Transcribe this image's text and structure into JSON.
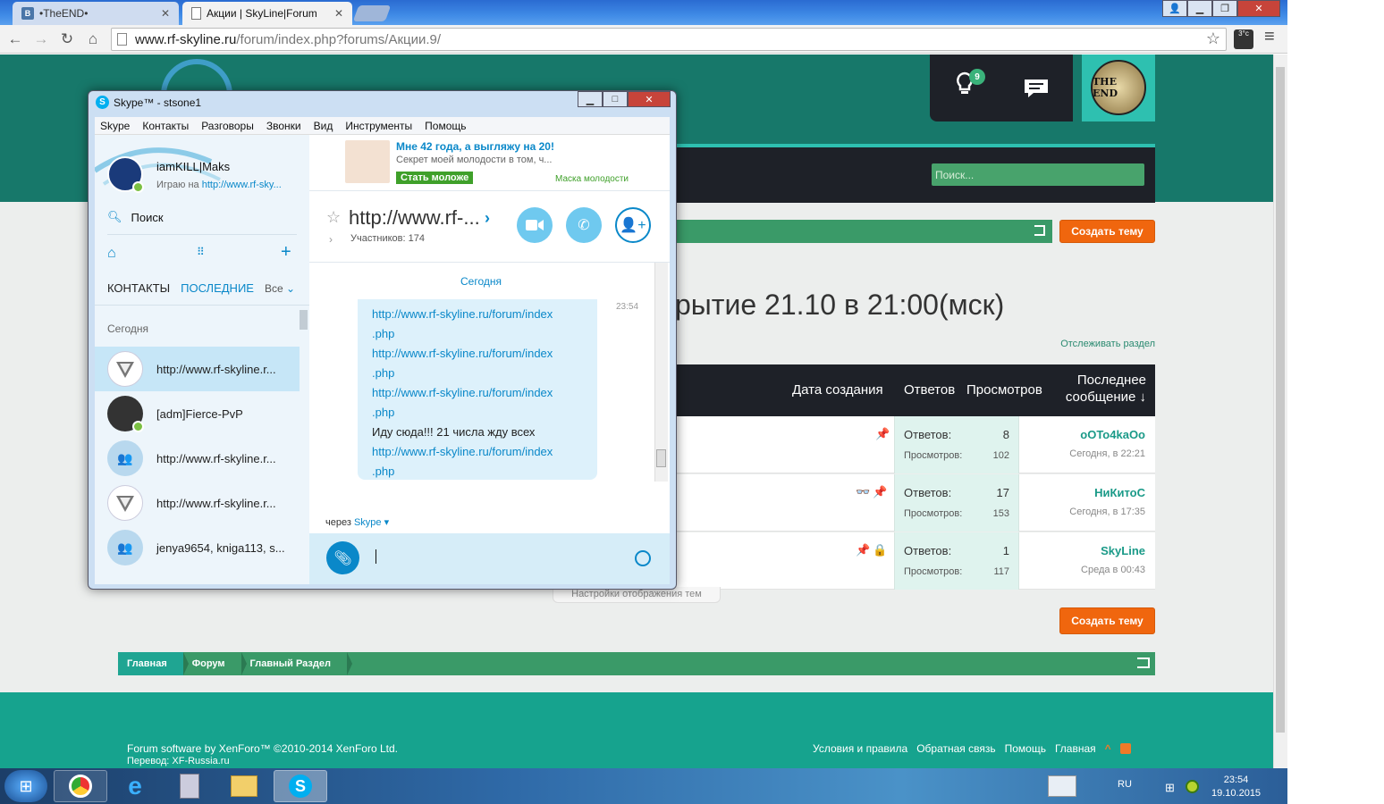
{
  "browser": {
    "tabs": [
      {
        "label": "•TheEND•",
        "favicon": "vk-icon"
      },
      {
        "label": "Акции | SkyLine|Forum",
        "favicon": "page-icon"
      }
    ],
    "url_host": "www.rf-skyline.ru",
    "url_path": "/forum/index.php?forums/Акции.9/",
    "ext_badge": "3°c"
  },
  "forum": {
    "alerts_count": "9",
    "avatar_text": "THE END",
    "search_placeholder": "Поиск...",
    "create_thread": "Создать тему",
    "title": "рытие 21.10 в 21:00(мск)",
    "watch_forum": "Отслеживать раздел",
    "columns": {
      "created": "Дата создания",
      "replies": "Ответов",
      "views": "Просмотров",
      "last1": "Последнее",
      "last2": "сообщение ↓"
    },
    "threads": [
      {
        "icons": "📌",
        "replies_label": "Ответов:",
        "replies": "8",
        "views_label": "Просмотров:",
        "views": "102",
        "last_user": "oOTo4kaOo",
        "last_date": "Сегодня, в 22:21"
      },
      {
        "icons": "👓📌",
        "replies_label": "Ответов:",
        "replies": "17",
        "views_label": "Просмотров:",
        "views": "153",
        "last_user": "НиКитоС",
        "last_date": "Сегодня, в 17:35"
      },
      {
        "icons": "📌🔒",
        "replies_label": "Ответов:",
        "replies": "1",
        "views_label": "Просмотров:",
        "views": "117",
        "last_user": "SkyLine",
        "last_date": "Среда в 00:43"
      }
    ],
    "display_settings": "Настройки отображения тем",
    "breadcrumb": [
      "Главная",
      "Форум",
      "Главный Раздел"
    ],
    "footer": {
      "copyright": "Forum software by XenForo™ ©2010-2014 XenForo Ltd.",
      "translation": "Перевод: XF-Russia.ru",
      "links": [
        "Условия и правила",
        "Обратная связь",
        "Помощь",
        "Главная"
      ]
    }
  },
  "skype": {
    "window_title": "Skype™ - stsone1",
    "menu": [
      "Skype",
      "Контакты",
      "Разговоры",
      "Звонки",
      "Вид",
      "Инструменты",
      "Помощь"
    ],
    "profile_name": "iamKILL|Maks",
    "profile_mood_prefix": "Играю на ",
    "profile_mood_link": "http://www.rf-sky...",
    "search_label": "Поиск",
    "tab_contacts": "КОНТАКТЫ",
    "tab_recent": "ПОСЛЕДНИЕ",
    "tab_filter": "Все",
    "today": "Сегодня",
    "contacts": [
      {
        "name": "http://www.rf-skyline.r...",
        "avatar": "emblem-icon",
        "selected": true
      },
      {
        "name": "[adm]Fierce-PvP",
        "avatar": "photo-icon",
        "selected": false
      },
      {
        "name": "http://www.rf-skyline.r...",
        "avatar": "group-icon",
        "selected": false
      },
      {
        "name": "http://www.rf-skyline.r...",
        "avatar": "emblem-icon",
        "selected": false
      },
      {
        "name": "jenya9654, kniga113, s...",
        "avatar": "group-icon",
        "selected": false
      }
    ],
    "ad": {
      "title": "Мне 42 года, а выгляжу на 20!",
      "subtitle": "Секрет моей молодости в том, ч...",
      "button": "Стать моложе",
      "link": "Маска молодости"
    },
    "chat_title": "http://www.rf-...",
    "members": "Участников: 174",
    "day_label": "Сегодня",
    "message_time": "23:54",
    "messages": [
      {
        "text": "http://www.rf-skyline.ru/forum/index",
        "link": true
      },
      {
        "text": ".php",
        "link": true
      },
      {
        "text": "http://www.rf-skyline.ru/forum/index",
        "link": true
      },
      {
        "text": ".php",
        "link": true
      },
      {
        "text": "http://www.rf-skyline.ru/forum/index",
        "link": true
      },
      {
        "text": ".php",
        "link": true
      },
      {
        "text": "Иду сюда!!! 21 числа жду всех",
        "link": false
      },
      {
        "text": "http://www.rf-skyline.ru/forum/index",
        "link": true
      },
      {
        "text": ".php",
        "link": true
      }
    ],
    "via_prefix": "через ",
    "via_link": "Skype ▾"
  },
  "taskbar": {
    "lang": "RU",
    "time": "23:54",
    "date": "19.10.2015"
  },
  "colors": {
    "teal": "#17786a",
    "green": "#3a9a68",
    "orange": "#f0660e",
    "skype_blue": "#0a88c9"
  }
}
